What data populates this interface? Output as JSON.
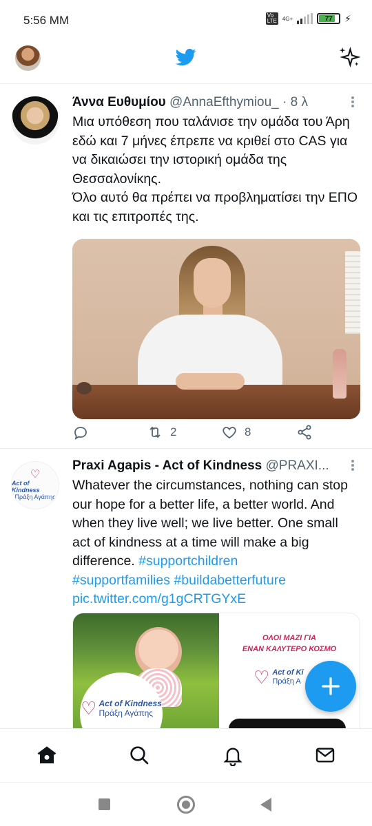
{
  "status": {
    "time": "5:56 MM",
    "volte": "Vo LTE",
    "network": "4G+",
    "battery": "77"
  },
  "header": {
    "avatar_icon": "profile-avatar",
    "logo_icon": "twitter-bird-icon",
    "sparkle_icon": "sparkle-icon"
  },
  "tweets": [
    {
      "name": "Άννα Ευθυμίου",
      "handle": "@AnnaEfthymiou_",
      "time": "· 8 λ",
      "text": "Μια υπόθεση που ταλάνισε την ομάδα του Άρη εδώ και 7 μήνες έπρεπε να κριθεί στο CAS για να δικαιώσει την ιστορική ομάδα της Θεσσαλονίκης.\nΌλο αυτό θα πρέπει να προβληματίσει την ΕΠΟ και τις επιτροπές της.",
      "retweets": "2",
      "likes": "8"
    },
    {
      "name": "Praxi Agapis - Act of Kindness",
      "handle": "@PRAXI...",
      "text_plain": "Whatever the circumstances, nothing can stop  our hope for a better life, a better world. And when they live well; we live better. One small act of kindness at a time will make a big difference. ",
      "hashtag1": "#supportchildren",
      "hashtag2": "#supportfamilies",
      "hashtag3": "#buildabetterfuture",
      "pic_link": "pic.twitter.com/g1gCRTGYxE",
      "logo_line1": "Act of Kindness",
      "logo_line2": "Πράξη Αγάπης",
      "card_slogan_line1": "ΟΛΟΙ ΜΑΖΙ ΓΙΑ",
      "card_slogan_line2": "ΕΝΑΝ ΚΑΛΥΤΕΡΟ ΚΟΣΜΟ",
      "card_logo_line1": "Act of Ki",
      "card_logo_line2": "Πράξη Α"
    }
  ],
  "colors": {
    "accent": "#1d9bf0",
    "text": "#0f1419",
    "muted": "#536471",
    "brand_pink": "#d1245a",
    "brand_blue": "#2b56a8"
  },
  "nav": [
    "home-icon",
    "search-icon",
    "notifications-icon",
    "messages-icon"
  ]
}
